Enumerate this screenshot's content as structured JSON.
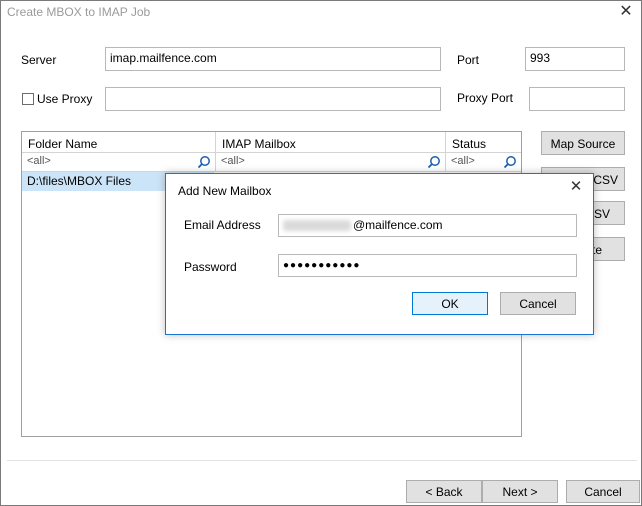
{
  "window": {
    "title": "Create MBOX to IMAP Job",
    "close_glyph": "✕"
  },
  "form": {
    "server_label": "Server",
    "server_value": "imap.mailfence.com",
    "port_label": "Port",
    "port_value": "993",
    "use_proxy_label": "Use Proxy",
    "use_proxy_checked": false,
    "proxy_value": "",
    "proxy_port_label": "Proxy Port",
    "proxy_port_value": ""
  },
  "grid": {
    "columns": [
      "Folder Name",
      "IMAP Mailbox",
      "Status"
    ],
    "filters": [
      "<all>",
      "<all>",
      "<all>"
    ],
    "rows": [
      {
        "folder": "D:\\files\\MBOX Files"
      }
    ]
  },
  "side_buttons": {
    "map_source": "Map Source",
    "csv_1_partial": "CSV",
    "csv_2_partial": "CSV",
    "partial_3": "te"
  },
  "dialog": {
    "title": "Add New Mailbox",
    "close_glyph": "✕",
    "email_label": "Email Address",
    "email_domain": "@mailfence.com",
    "password_label": "Password",
    "password_mask": "●●●●●●●●●●●",
    "ok_label": "OK",
    "cancel_label": "Cancel"
  },
  "footer": {
    "back_label": "< Back",
    "next_label": "Next >",
    "cancel_label": "Cancel"
  },
  "icons": [
    "search-icon",
    "close-icon",
    "checkbox"
  ],
  "colors": {
    "accent": "#1b73d4",
    "selection": "#cce4f7",
    "button_bg": "#e1e1e1"
  }
}
